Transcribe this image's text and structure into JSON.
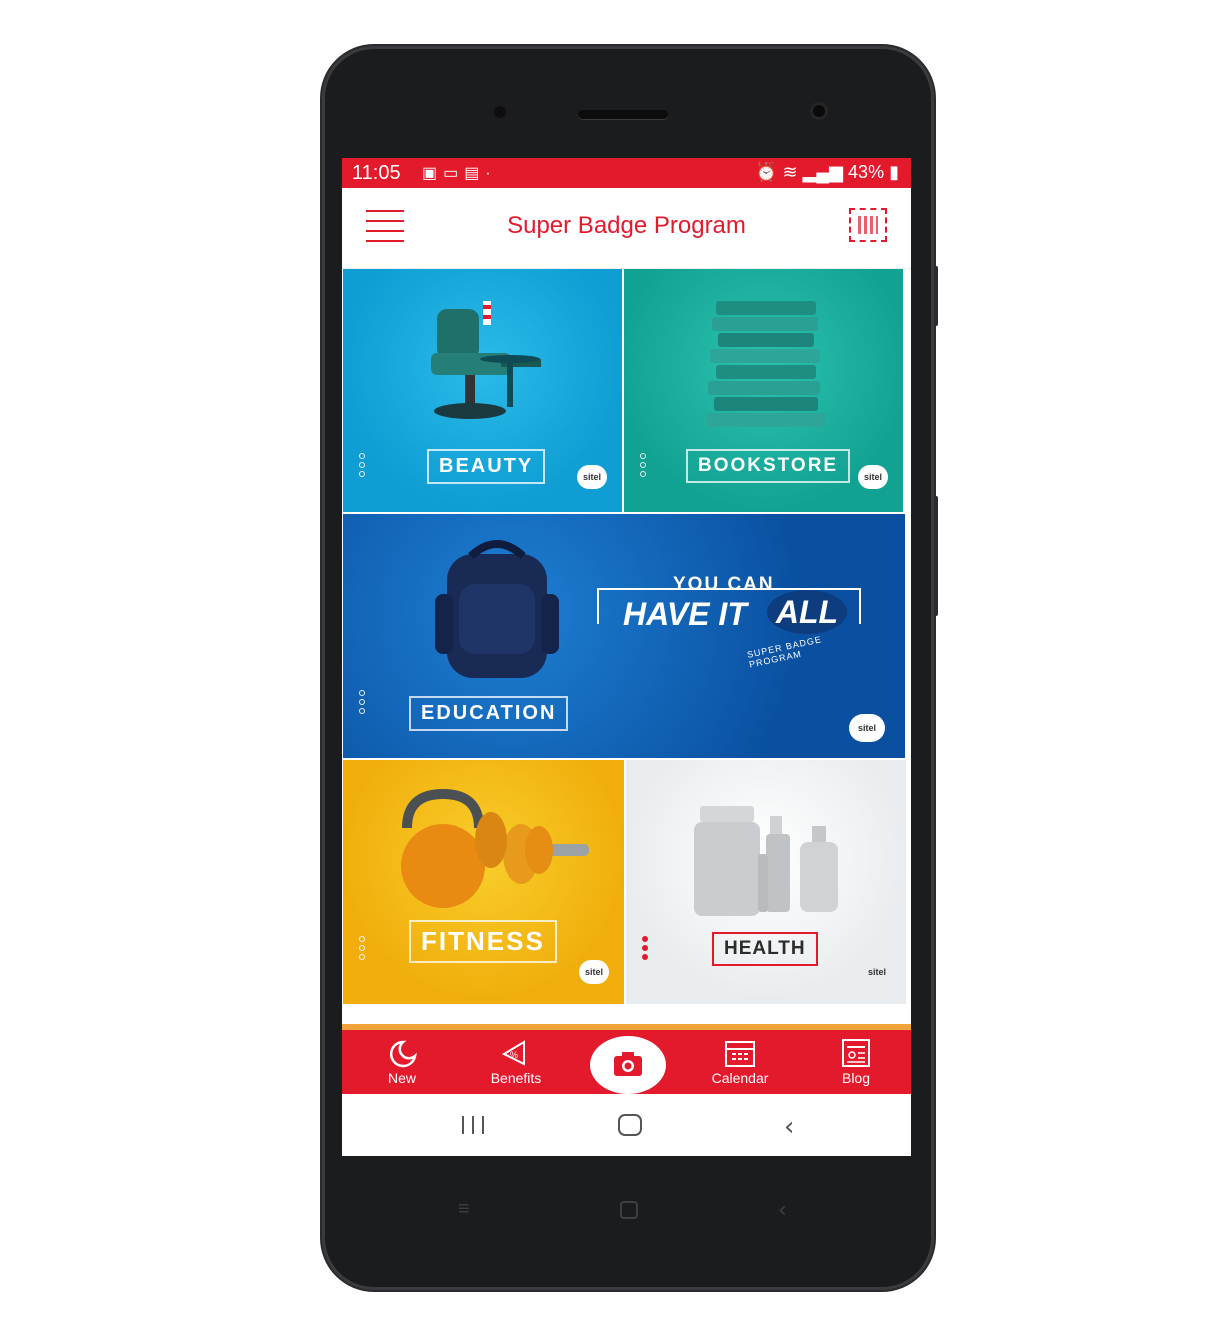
{
  "status_bar": {
    "time": "11:05",
    "battery": "43%",
    "left_icons": [
      "gallery-icon",
      "laptop-icon",
      "message-icon"
    ],
    "right_icons": [
      "alarm-icon",
      "wifi-icon",
      "signal-icon",
      "battery-icon"
    ]
  },
  "app_bar": {
    "title": "Super Badge Program",
    "menu_icon": "hamburger-menu-icon",
    "qr_icon": "qr-code-icon"
  },
  "tiles": [
    {
      "label": "BEAUTY",
      "image": "barber-chair",
      "color": "#13a6dc"
    },
    {
      "label": "BOOKSTORE",
      "image": "book-stack",
      "color": "#17a99a"
    },
    {
      "label": "EDUCATION",
      "image": "backpack",
      "color": "#0f5fb4"
    },
    {
      "label": "FITNESS",
      "image": "kettlebell-dumbbell",
      "color": "#f3b813"
    },
    {
      "label": "HEALTH",
      "image": "medicine-bottles",
      "color": "#f2f2f2"
    }
  ],
  "banner": {
    "line1": "YOU CAN",
    "line2": "HAVE IT",
    "line2b": "ALL",
    "badge": "SUPER BADGE PROGRAM"
  },
  "brand": "sitel",
  "bottom_nav": {
    "items": [
      {
        "label": "New",
        "icon": "moon-icon"
      },
      {
        "label": "Benefits",
        "icon": "megaphone-icon"
      },
      {
        "label": "Calendar",
        "icon": "calendar-icon"
      },
      {
        "label": "Blog",
        "icon": "news-icon"
      }
    ],
    "camera_icon": "camera-icon",
    "active_color": "#e3192c"
  },
  "system_nav": [
    "recents-icon",
    "home-icon",
    "back-icon"
  ]
}
